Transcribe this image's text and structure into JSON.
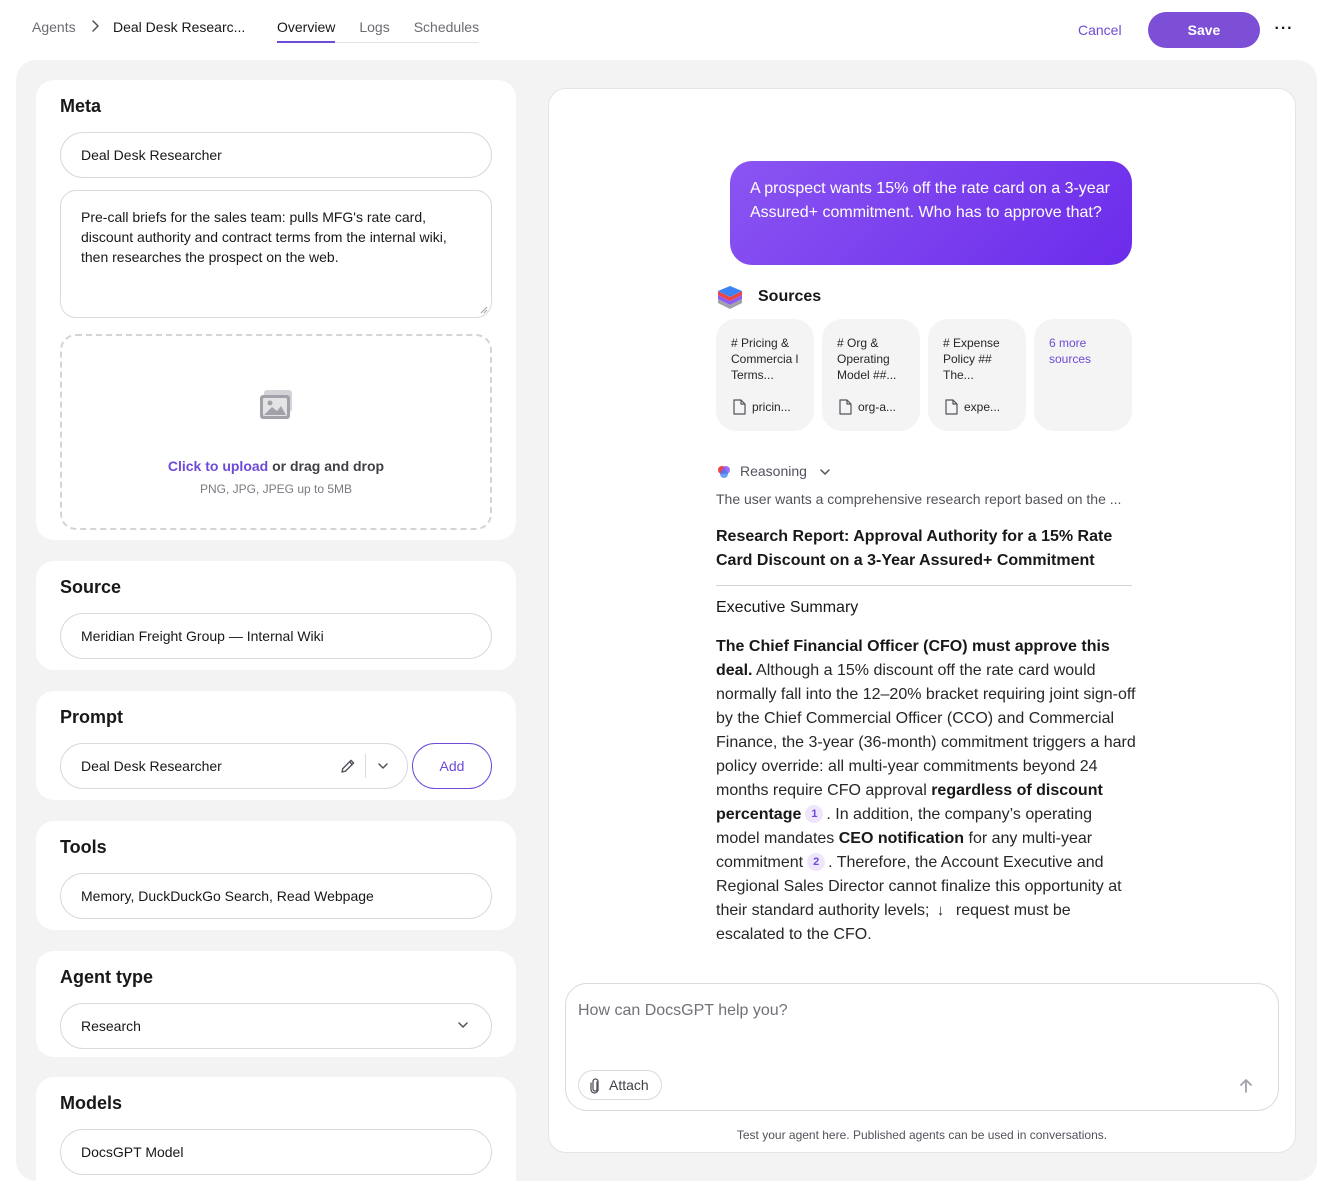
{
  "header": {
    "breadcrumb_root": "Agents",
    "breadcrumb_current": "Deal Desk Researc...",
    "tabs": [
      "Overview",
      "Logs",
      "Schedules"
    ],
    "cancel_label": "Cancel",
    "save_label": "Save",
    "more_label": "···"
  },
  "meta": {
    "title": "Meta",
    "name_value": "Deal Desk Researcher",
    "description_value": "Pre-call briefs for the sales team: pulls MFG's rate card, discount authority and contract terms from the internal wiki, then researches the prospect on the web.",
    "upload_link": "Click to upload",
    "upload_rest": " or drag and drop",
    "upload_hint": "PNG, JPG, JPEG up to 5MB"
  },
  "source": {
    "title": "Source",
    "value": "Meridian Freight Group — Internal Wiki"
  },
  "prompt": {
    "title": "Prompt",
    "value": "Deal Desk Researcher",
    "add_label": "Add"
  },
  "tools": {
    "title": "Tools",
    "value": "Memory, DuckDuckGo Search, Read Webpage"
  },
  "agent_type": {
    "title": "Agent type",
    "value": "Research"
  },
  "models": {
    "title": "Models",
    "value": "DocsGPT Model"
  },
  "chat": {
    "user_message": "A prospect wants 15% off the rate card on a 3-year Assured+ commitment. Who has to approve that?",
    "sources_title": "Sources",
    "sources": [
      {
        "text": "# Pricing & Commercia l Terms...",
        "file": "pricin..."
      },
      {
        "text": "# Org & Operating Model ##...",
        "file": "org-a..."
      },
      {
        "text": "# Expense Policy ## The...",
        "file": "expe..."
      }
    ],
    "more_sources": "6 more sources",
    "reasoning_label": "Reasoning",
    "reasoning_text": "The user wants a comprehensive research report based on the ...",
    "report_title": "Research Report: Approval Authority for a 15% Rate Card Discount on a 3-Year Assured+ Commitment",
    "exec_heading": "Executive Summary",
    "p_bold1": "The Chief Financial Officer (CFO) must approve this deal.",
    "p_text1": " Although a 15% discount off the rate card would normally fall into the 12–20% bracket requiring joint sign-off by the Chief Commercial Officer (CCO) and Commercial Finance, the 3-year (36-month) commitment triggers a hard policy override: all multi-year commitments beyond 24 months require CFO approval ",
    "p_bold2": "regardless of discount percentage",
    "cite1": "1",
    "p_text2": ". In addition, the company’s operating model mandates ",
    "p_bold3": "CEO notification",
    "p_text3": " for any multi-year commitment",
    "cite2": "2",
    "p_text4": ". Therefore, the Account Executive and Regional Sales Director cannot finalize this opportunity at their standard authority levels;",
    "p_text5": " request must be escalated to the CFO.",
    "composer_placeholder": "How can DocsGPT help you?",
    "attach_label": "Attach",
    "footer_note": "Test your agent here. Published agents can be used in conversations."
  },
  "colors": {
    "accent": "#6d4bd6",
    "save_button": "#7c4fd6",
    "bubble_start": "#8a55f2",
    "bubble_end": "#6c2bea",
    "panel_bg": "#f3f3f4"
  },
  "icons": [
    "chevron-right-icon",
    "more-icon",
    "image-icon",
    "pencil-icon",
    "chevron-down-icon",
    "layers-icon",
    "file-icon",
    "reasoning-icon",
    "arrow-down-icon",
    "paperclip-icon",
    "arrow-up-icon"
  ]
}
